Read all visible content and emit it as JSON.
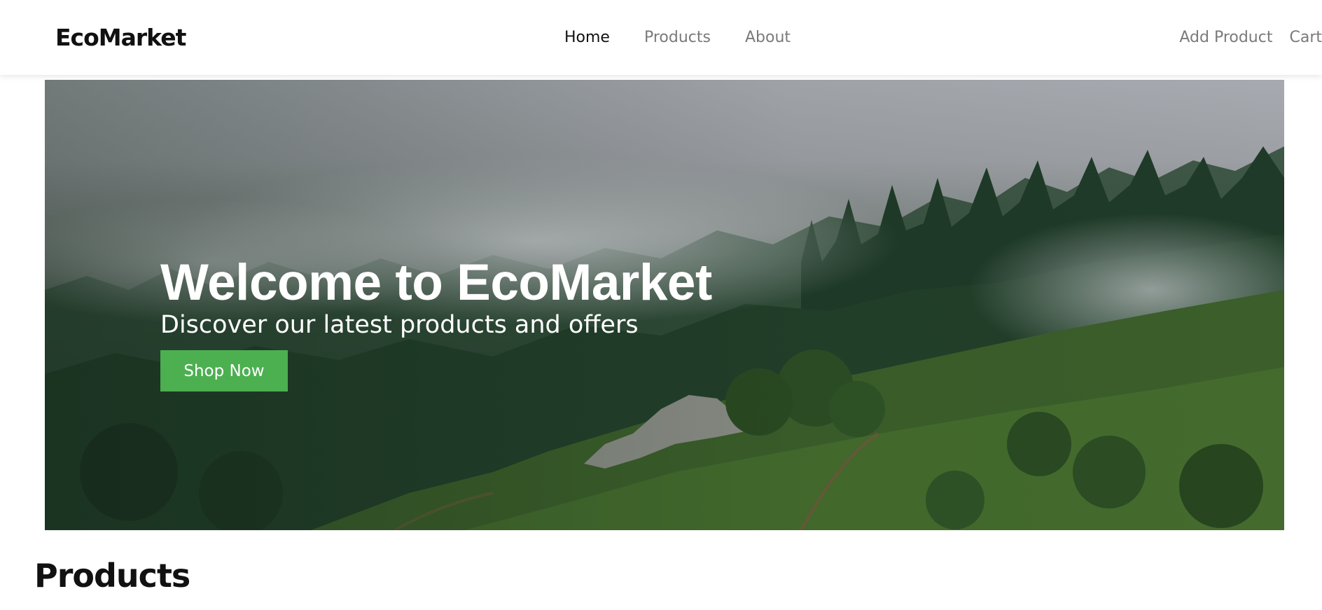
{
  "nav": {
    "brand": "EcoMarket",
    "links": [
      {
        "label": "Home",
        "active": true
      },
      {
        "label": "Products",
        "active": false
      },
      {
        "label": "About",
        "active": false
      }
    ],
    "right_links": [
      {
        "label": "Add Product"
      },
      {
        "label": "Cart"
      }
    ]
  },
  "hero": {
    "title": "Welcome to EcoMarket",
    "subtitle": "Discover our latest products and offers",
    "cta_label": "Shop Now",
    "cta_color": "#4caf50",
    "image": "misty-forest-hillside"
  },
  "products_section": {
    "title": "Products"
  }
}
